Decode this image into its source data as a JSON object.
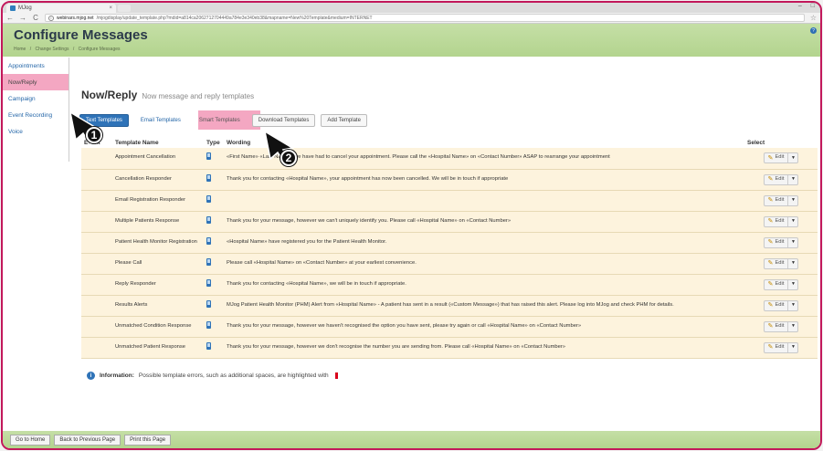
{
  "browser": {
    "tab_title": "MJog",
    "tab_close": "×",
    "window_controls": [
      "–",
      "□"
    ],
    "url_host": "webinars.mjog.net",
    "url_path": "/mjogdisplay/update_template.php?mdid=a814ca2062712704449a784e3e340eb38&mapname=New%20Template&medium=INTERNET",
    "star": "☆"
  },
  "header": {
    "title": "Configure Messages",
    "breadcrumb": [
      "Home",
      "/",
      "Change Settings",
      "/",
      "Configure Messages"
    ]
  },
  "sidebar": {
    "items": [
      {
        "label": "Appointments"
      },
      {
        "label": "Now/Reply"
      },
      {
        "label": "Campaign"
      },
      {
        "label": "Event Recording"
      },
      {
        "label": "Voice"
      }
    ]
  },
  "page": {
    "title": "Now/Reply",
    "subtitle": "Now message and reply templates"
  },
  "buttons": {
    "text_templates": "Text Templates",
    "email_templates": "Email Templates",
    "smart_templates": "Smart Templates",
    "download_templates": "Download Templates",
    "add_template": "Add Template"
  },
  "table": {
    "headers": {
      "event": "Event",
      "name": "Template Name",
      "type": "Type",
      "wording": "Wording",
      "select": "Select"
    },
    "edit_label": "Edit",
    "rows": [
      {
        "name": "Appointment Cancellation",
        "wording": "«First Name» «Last Name», we have had to cancel your appointment. Please call the «Hospital Name» on «Contact Number» ASAP to rearrange your appointment"
      },
      {
        "name": "Cancellation Responder",
        "wording": "Thank you for contacting «Hospital Name», your appointment has now been cancelled. We will be in touch if appropriate"
      },
      {
        "name": "Email Registration Responder",
        "wording": ""
      },
      {
        "name": "Multiple Patients Response",
        "wording": "Thank you for your message, however we can't uniquely identify you. Please call «Hospital Name» on «Contact Number»"
      },
      {
        "name": "Patient Health Monitor Registration",
        "wording": "«Hospital Name» have registered you for the Patient Health Monitor."
      },
      {
        "name": "Please Call",
        "wording": "Please call «Hospital Name» on «Contact Number» at your earliest convenience."
      },
      {
        "name": "Reply Responder",
        "wording": "Thank you for contacting «Hospital Name», we will be in touch if appropriate."
      },
      {
        "name": "Results Alerts",
        "wording": "MJog Patient Health Monitor (PHM) Alert from «Hospital Name» - A patient has sent in a result («Custom Message») that has raised this alert. Please log into MJog and check PHM for details."
      },
      {
        "name": "Unmatched Condition Response",
        "wording": "Thank you for your message, however we haven't recognised the option you have sent, please try again or call «Hospital Name» on «Contact Number»"
      },
      {
        "name": "Unmatched Patient Response",
        "wording": "Thank you for your message, however we don't recognise the number you are sending from. Please call «Hospital Name» on «Contact Number»"
      }
    ]
  },
  "info": {
    "label": "Information:",
    "text": "Possible template errors, such as additional spaces, are highlighted with"
  },
  "footer": {
    "buttons": [
      "Go to Home",
      "Back to Previous Page",
      "Print this Page"
    ]
  },
  "callouts": [
    "1",
    "2"
  ],
  "colors": {
    "highlight_pink": "#f4a7c2",
    "header_green": "#c5dfa6",
    "primary_blue": "#2f73b8",
    "row_bg": "#fdf3dd",
    "frame_border": "#c2185b"
  }
}
